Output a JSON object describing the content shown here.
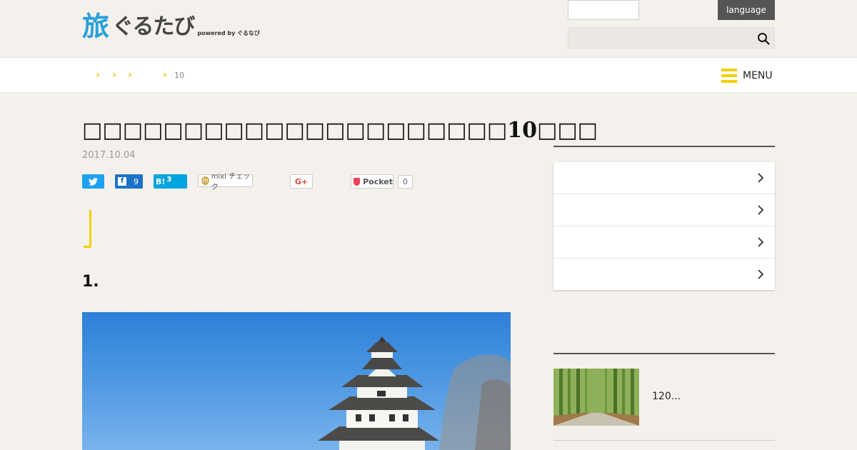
{
  "header": {
    "logo_mark": "旅",
    "logo_text": "ぐるたび",
    "logo_powered": "powered by ぐるなび",
    "language_label": "language",
    "search_placeholder": ""
  },
  "breadcrumb": {
    "chevron": "›",
    "last_item": "10"
  },
  "nav": {
    "menu_label": "MENU"
  },
  "article": {
    "title": "□□□□□□□□□□□□□□□□□□□□□10□□□",
    "date": "2017.10.04",
    "section_heading": "1."
  },
  "share": {
    "facebook_count": "9",
    "hatena_label": "B!",
    "hatena_count": "3",
    "mixi_label": "mixi チェック",
    "gplus_label": "G+",
    "pocket_label": "Pocket",
    "pocket_count": "0"
  },
  "sidebar": {
    "thumb_title": "120..."
  },
  "colors": {
    "accent_yellow": "#f2d000",
    "twitter": "#1da1f2",
    "facebook": "#1a73c8",
    "hatena": "#00a4de",
    "pocket": "#ef4056"
  }
}
